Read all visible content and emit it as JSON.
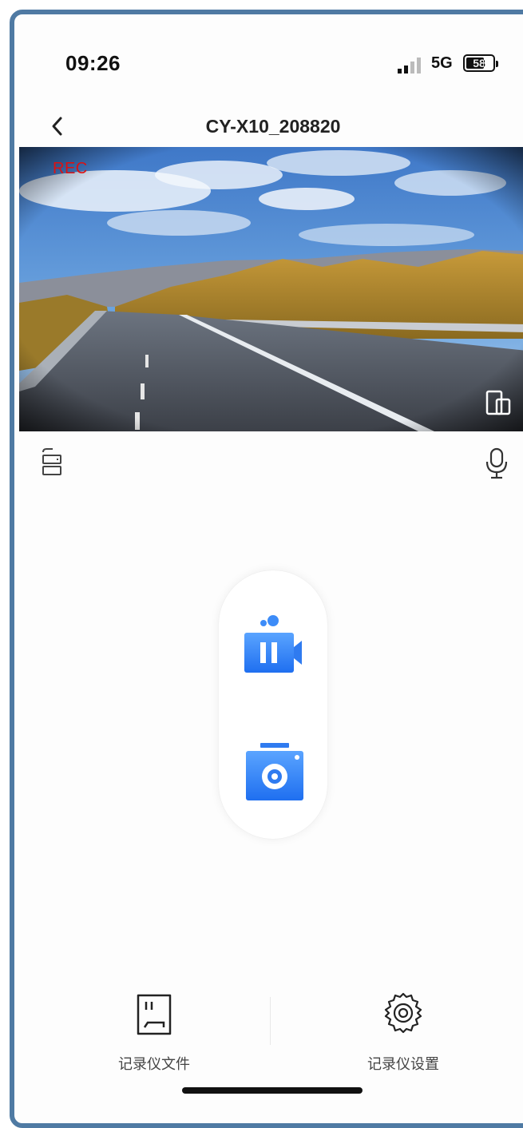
{
  "status": {
    "time": "09:26",
    "network": "5G",
    "battery": "58"
  },
  "nav": {
    "title": "CY-X10_208820",
    "back_icon": "chevron-left-icon"
  },
  "video": {
    "rec_label": "REC",
    "fullscreen_icon": "fullscreen-icon"
  },
  "tools": {
    "rotate_icon": "rotate-icon",
    "mic_icon": "microphone-icon"
  },
  "controls": {
    "record_icon": "video-pause-icon",
    "snapshot_icon": "camera-icon",
    "accent": "#2f7bf0"
  },
  "bottom": {
    "files_label": "记录仪文件",
    "settings_label": "记录仪设置"
  }
}
